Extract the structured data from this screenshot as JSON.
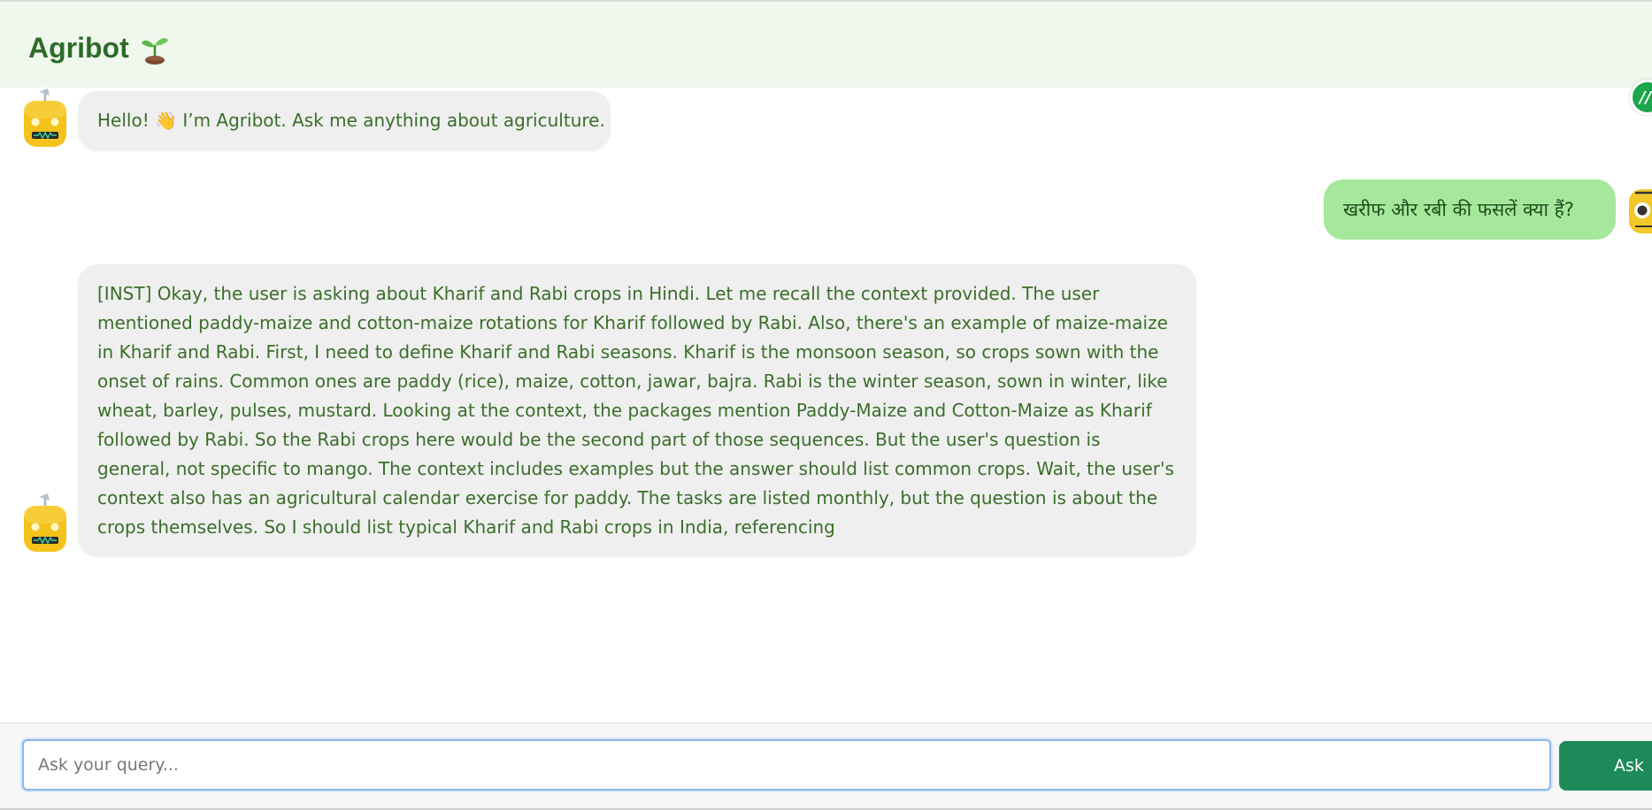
{
  "header": {
    "title": "Agribot",
    "icon": "sprout-icon"
  },
  "side_badge": {
    "label": "//c"
  },
  "messages": [
    {
      "role": "bot",
      "text": "Hello! 👋 I’m Agribot. Ask me anything about agriculture."
    },
    {
      "role": "user",
      "text": "खरीफ और रबी की फसलें क्या हैं?"
    },
    {
      "role": "bot",
      "text": "[INST] Okay, the user is asking about Kharif and Rabi crops in Hindi. Let me recall the context provided. The user mentioned paddy-maize and cotton-maize rotations for Kharif followed by Rabi. Also, there's an example of maize-maize in Kharif and Rabi. First, I need to define Kharif and Rabi seasons. Kharif is the monsoon season, so crops sown with the onset of rains. Common ones are paddy (rice), maize, cotton, jawar, bajra. Rabi is the winter season, sown in winter, like wheat, barley, pulses, mustard. Looking at the context, the packages mention Paddy-Maize and Cotton-Maize as Kharif followed by Rabi. So the Rabi crops here would be the second part of those sequences. But the user's question is general, not specific to mango. The context includes examples but the answer should list common crops. Wait, the user's context also has an agricultural calendar exercise for paddy. The tasks are listed monthly, but the question is about the crops themselves. So I should list typical Kharif and Rabi crops in India, referencing"
    }
  ],
  "input": {
    "placeholder": "Ask your query...",
    "value": ""
  },
  "ask_button": {
    "label": "Ask"
  },
  "colors": {
    "header_bg": "#f0f8ee",
    "title": "#2e6b2a",
    "bot_bubble": "#efefef",
    "bot_text": "#3a6e2a",
    "user_bubble": "#a6e89b",
    "ask_button": "#1e8a5a"
  }
}
